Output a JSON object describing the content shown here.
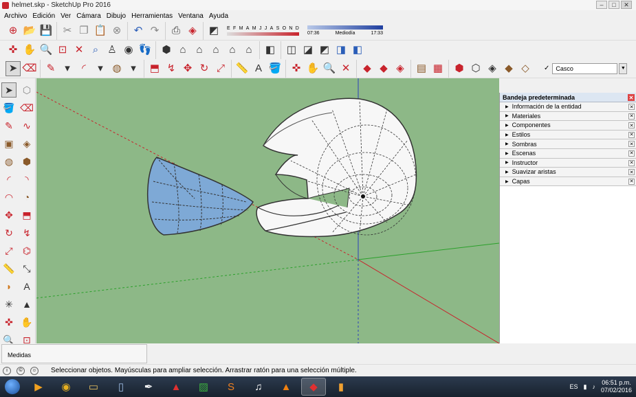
{
  "window": {
    "title": "helmet.skp - SketchUp Pro 2016"
  },
  "menu": [
    "Archivo",
    "Edición",
    "Ver",
    "Cámara",
    "Dibujo",
    "Herramientas",
    "Ventana",
    "Ayuda"
  ],
  "shadows": {
    "months": [
      "E",
      "F",
      "M",
      "A",
      "M",
      "J",
      "J",
      "A",
      "S",
      "O",
      "N",
      "D"
    ],
    "time_start": "07:36",
    "time_mid": "Mediodía",
    "time_end": "17:33"
  },
  "layers": {
    "check": "✓",
    "current": "Casco"
  },
  "tray": {
    "title": "Bandeja predeterminada",
    "items": [
      "Información de la entidad",
      "Materiales",
      "Componentes",
      "Estilos",
      "Sombras",
      "Escenas",
      "Instructor",
      "Suavizar aristas",
      "Capas"
    ]
  },
  "measurements": {
    "label": "Medidas"
  },
  "status": {
    "message": "Seleccionar objetos. Mayúsculas para ampliar selección. Arrastrar ratón para una selección múltiple."
  },
  "taskbar": {
    "lang": "ES",
    "time": "06:51 p.m.",
    "date": "07/02/2016"
  },
  "colors": {
    "viewport": "#8db887",
    "axis_red": "#c8232c",
    "axis_green": "#2aa02a",
    "axis_blue": "#2b3fb8",
    "visor": "#7ea9d6"
  }
}
